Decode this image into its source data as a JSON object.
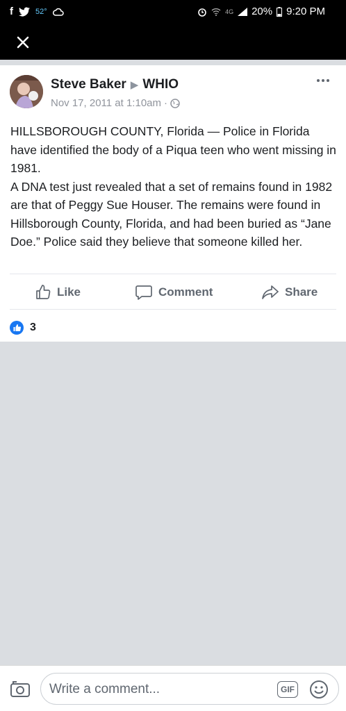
{
  "status_bar": {
    "temperature": "52°",
    "battery": "20%",
    "time": "9:20 PM",
    "network": "4G"
  },
  "post": {
    "author": "Steve Baker",
    "target": "WHIO",
    "timestamp": "Nov 17, 2011 at 1:10am",
    "paragraphs": [
      "HILLSBOROUGH COUNTY, Florida —  Police in Florida have identified the body of a Piqua teen who went missing in 1981.",
      "A DNA test just revealed that a set of remains found in 1982 are that of Peggy Sue Houser. The remains were found in Hillsborough County, Florida, and had been buried as “Jane Doe.” Police said they believe that someone killed her."
    ],
    "like_label": "Like",
    "comment_label": "Comment",
    "share_label": "Share",
    "like_count": "3"
  },
  "composer": {
    "placeholder": "Write a comment...",
    "gif_label": "GIF"
  },
  "colors": {
    "brand_blue": "#1877f2",
    "text": "#1c1e21",
    "muted": "#606770",
    "background": "#dadde1"
  }
}
